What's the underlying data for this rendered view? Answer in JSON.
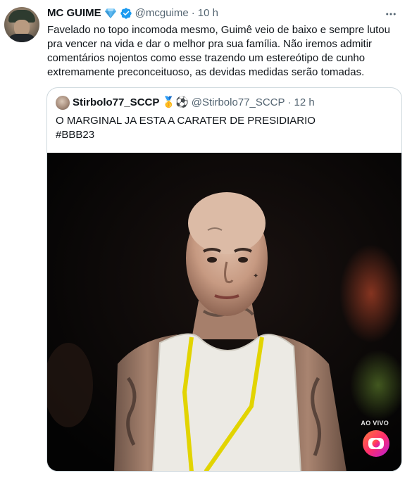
{
  "tweet": {
    "display_name": "MC GUIME",
    "handle": "@mcguime",
    "separator": "·",
    "time": "10 h",
    "text": "Favelado no topo incomoda mesmo, Guimê veio de baixo e sempre lutou\npra vencer na vida e dar o melhor pra sua família. Não iremos admitir\ncomentários nojentos como esse trazendo um estereótipo de cunho\nextremamente preconceituoso, as devidas medidas serão tomadas."
  },
  "quoted": {
    "display_name": "Stirbolo77_SCCP",
    "emojis": "🥇⚽",
    "handle": "@Stirbolo77_SCCP",
    "separator": "·",
    "time": "12 h",
    "text": "O MARGINAL JA ESTA A CARATER DE PRESIDIARIO\n#BBB23",
    "media": {
      "live_badge": "AO VIVO"
    }
  },
  "colors": {
    "text": "#0f1419",
    "muted": "#536471",
    "verified": "#1d9bf0",
    "border": "#cfd9de",
    "diamond": "#5db8f0"
  },
  "icons": {
    "diamond": "gem-icon",
    "verified": "verified-badge-icon",
    "more": "more-horizontal-icon",
    "tv_logo": "globo-logo-icon"
  }
}
